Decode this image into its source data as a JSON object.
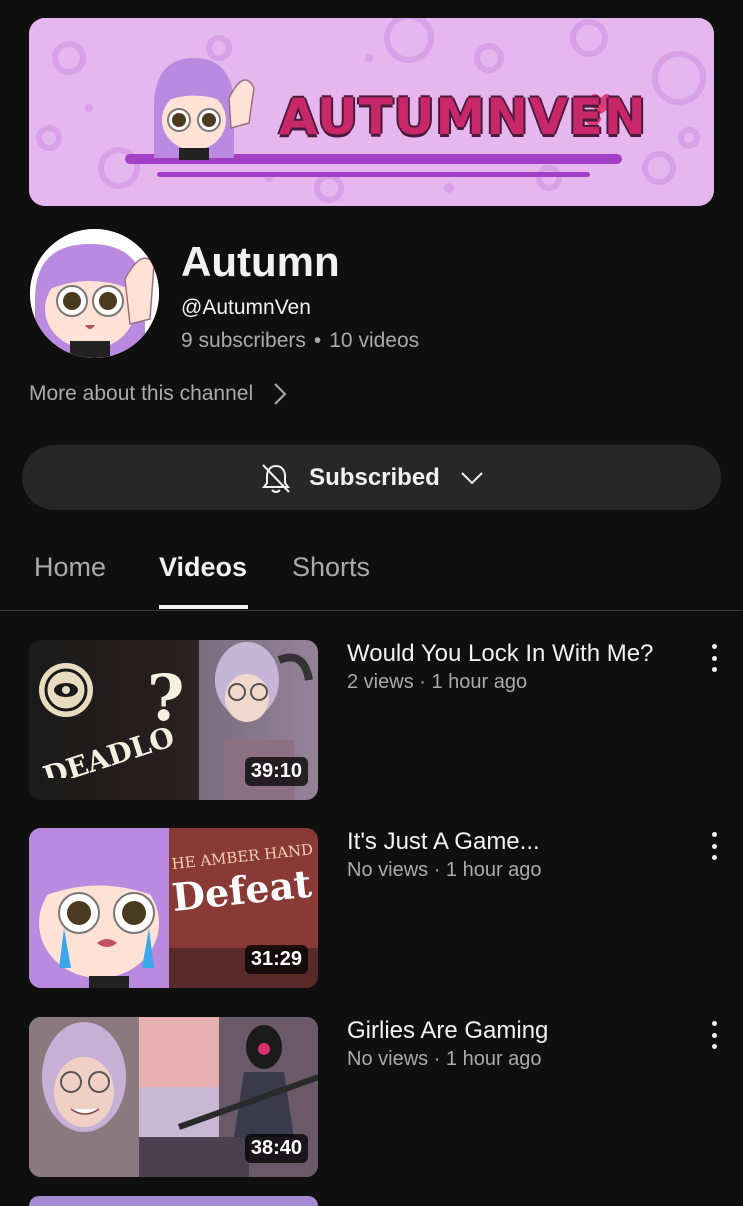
{
  "banner": {
    "title": "AUTUMNVEN"
  },
  "channel": {
    "name": "Autumn",
    "handle": "@AutumnVen",
    "subscribers": "9 subscribers",
    "separator": "•",
    "video_count": "10 videos",
    "more_about": "More about this channel"
  },
  "subscribe_button": {
    "label": "Subscribed"
  },
  "tabs": [
    {
      "label": "Home",
      "active": false
    },
    {
      "label": "Videos",
      "active": true
    },
    {
      "label": "Shorts",
      "active": false
    }
  ],
  "videos": [
    {
      "title": "Would You Lock In With Me?",
      "meta": "2 views · 1 hour ago",
      "duration": "39:10",
      "thumb_text": "DEADLOCK"
    },
    {
      "title": "It's Just A Game...",
      "meta": "No views · 1 hour ago",
      "duration": "31:29",
      "thumb_text_top": "HE AMBER HAND",
      "thumb_text_big": "Defeat"
    },
    {
      "title": "Girlies Are Gaming",
      "meta": "No views · 1 hour ago",
      "duration": "38:40"
    }
  ],
  "colors": {
    "background": "#0f0f0f",
    "banner": "#e8b8f0",
    "button": "#272727",
    "secondary_text": "#aaaaaa"
  }
}
